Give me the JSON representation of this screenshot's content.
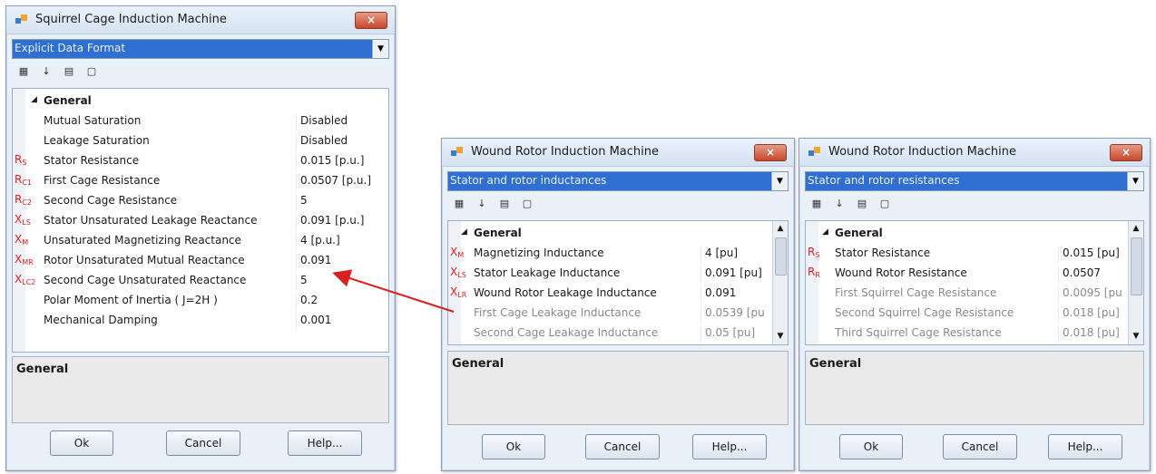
{
  "dialogs": [
    {
      "title": "Squirrel Cage Induction Machine",
      "close_label": "×",
      "combo_value": "Explicit Data Format",
      "section": "General",
      "rows": [
        {
          "sym": "",
          "sub": "",
          "name": "Mutual Saturation",
          "value": "Disabled",
          "gray": false
        },
        {
          "sym": "",
          "sub": "",
          "name": "Leakage Saturation",
          "value": "Disabled",
          "gray": false
        },
        {
          "sym": "R",
          "sub": "S",
          "name": "Stator Resistance",
          "value": "0.015 [p.u.]",
          "gray": false
        },
        {
          "sym": "R",
          "sub": "C1",
          "name": "First Cage Resistance",
          "value": "0.0507 [p.u.]",
          "gray": false
        },
        {
          "sym": "R",
          "sub": "C2",
          "name": "Second Cage Resistance",
          "value": "5",
          "gray": false
        },
        {
          "sym": "X",
          "sub": "LS",
          "name": "Stator Unsaturated Leakage Reactance",
          "value": "0.091 [p.u.]",
          "gray": false
        },
        {
          "sym": "X",
          "sub": "M",
          "name": "Unsaturated Magnetizing Reactance",
          "value": "4 [p.u.]",
          "gray": false
        },
        {
          "sym": "X",
          "sub": "MR",
          "name": "Rotor Unsaturated Mutual Reactance",
          "value": "0.091",
          "gray": false
        },
        {
          "sym": "X",
          "sub": "LC2",
          "name": "Second Cage Unsaturated Reactance",
          "value": "5",
          "gray": false
        },
        {
          "sym": "",
          "sub": "",
          "name": "Polar Moment of Inertia ( J=2H )",
          "value": "0.2",
          "gray": false
        },
        {
          "sym": "",
          "sub": "",
          "name": "Mechanical Damping",
          "value": "0.001",
          "gray": false
        }
      ],
      "desc_heading": "General",
      "buttons": {
        "ok": "Ok",
        "cancel": "Cancel",
        "help": "Help..."
      }
    },
    {
      "title": "Wound Rotor Induction Machine",
      "close_label": "×",
      "combo_value": "Stator and rotor inductances",
      "section": "General",
      "rows": [
        {
          "sym": "X",
          "sub": "M",
          "name": "Magnetizing Inductance",
          "value": "4 [pu]",
          "gray": false
        },
        {
          "sym": "X",
          "sub": "LS",
          "name": "Stator Leakage Inductance",
          "value": "0.091 [pu]",
          "gray": false
        },
        {
          "sym": "X",
          "sub": "LR",
          "name": "Wound Rotor Leakage Inductance",
          "value": "0.091",
          "gray": false
        },
        {
          "sym": "",
          "sub": "",
          "name": "First Cage Leakage Inductance",
          "value": "0.0539 [pu",
          "gray": true
        },
        {
          "sym": "",
          "sub": "",
          "name": "Second Cage Leakage Inductance",
          "value": "0.05 [pu]",
          "gray": true
        }
      ],
      "desc_heading": "General",
      "buttons": {
        "ok": "Ok",
        "cancel": "Cancel",
        "help": "Help..."
      }
    },
    {
      "title": "Wound Rotor Induction Machine",
      "close_label": "×",
      "combo_value": "Stator and rotor resistances",
      "section": "General",
      "rows": [
        {
          "sym": "R",
          "sub": "S",
          "name": "Stator Resistance",
          "value": "0.015 [pu]",
          "gray": false
        },
        {
          "sym": "R",
          "sub": "R",
          "name": "Wound Rotor Resistance",
          "value": "0.0507",
          "gray": false
        },
        {
          "sym": "",
          "sub": "",
          "name": "First Squirrel Cage Resistance",
          "value": "0.0095 [pu",
          "gray": true
        },
        {
          "sym": "",
          "sub": "",
          "name": "Second Squirrel Cage Resistance",
          "value": "0.018 [pu]",
          "gray": true
        },
        {
          "sym": "",
          "sub": "",
          "name": "Third Squirrel Cage Resistance",
          "value": "0.018 [pu]",
          "gray": true
        }
      ],
      "desc_heading": "General",
      "buttons": {
        "ok": "Ok",
        "cancel": "Cancel",
        "help": "Help..."
      }
    }
  ],
  "colors": {
    "symbol": "#e02020",
    "combo_bg": "#2f6fd1",
    "arrow": "#d9201f"
  }
}
